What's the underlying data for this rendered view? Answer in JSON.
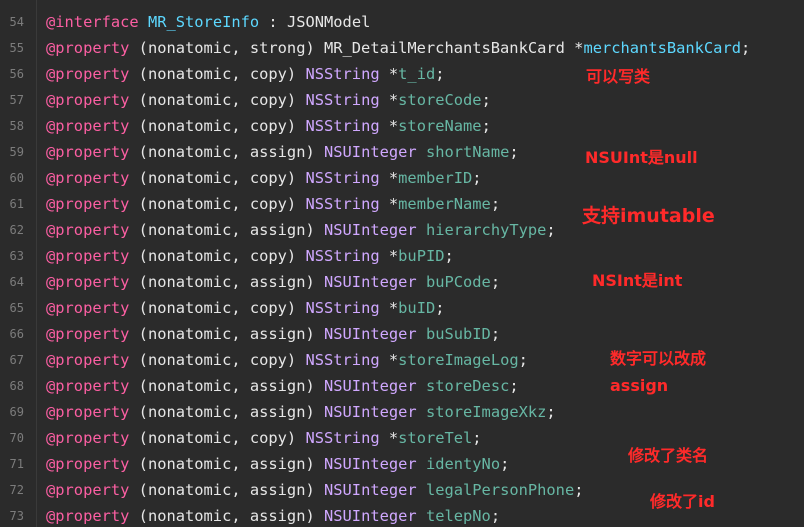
{
  "lines": [
    {
      "num": "54",
      "tokens": [
        {
          "t": "@interface",
          "c": "kw"
        },
        {
          "t": " ",
          "c": "plain"
        },
        {
          "t": "MR_StoreInfo",
          "c": "cls"
        },
        {
          "t": " : JSONModel",
          "c": "plain"
        }
      ]
    },
    {
      "num": "55",
      "tokens": [
        {
          "t": "@property",
          "c": "kw"
        },
        {
          "t": " (nonatomic, strong) MR_DetailMerchantsBankCard *",
          "c": "plain"
        },
        {
          "t": "merchantsBankCard",
          "c": "cls"
        },
        {
          "t": ";",
          "c": "plain"
        }
      ]
    },
    {
      "num": "56",
      "tokens": [
        {
          "t": "@property",
          "c": "kw"
        },
        {
          "t": " (nonatomic, copy) ",
          "c": "plain"
        },
        {
          "t": "NSString",
          "c": "type"
        },
        {
          "t": " *",
          "c": "plain"
        },
        {
          "t": "t_id",
          "c": "prop"
        },
        {
          "t": ";",
          "c": "plain"
        }
      ]
    },
    {
      "num": "57",
      "tokens": [
        {
          "t": "@property",
          "c": "kw"
        },
        {
          "t": " (nonatomic, copy) ",
          "c": "plain"
        },
        {
          "t": "NSString",
          "c": "type"
        },
        {
          "t": " *",
          "c": "plain"
        },
        {
          "t": "storeCode",
          "c": "prop"
        },
        {
          "t": ";",
          "c": "plain"
        }
      ]
    },
    {
      "num": "58",
      "tokens": [
        {
          "t": "@property",
          "c": "kw"
        },
        {
          "t": " (nonatomic, copy) ",
          "c": "plain"
        },
        {
          "t": "NSString",
          "c": "type"
        },
        {
          "t": " *",
          "c": "plain"
        },
        {
          "t": "storeName",
          "c": "prop"
        },
        {
          "t": ";",
          "c": "plain"
        }
      ]
    },
    {
      "num": "59",
      "tokens": [
        {
          "t": "@property",
          "c": "kw"
        },
        {
          "t": " (nonatomic, assign) ",
          "c": "plain"
        },
        {
          "t": "NSUInteger",
          "c": "type"
        },
        {
          "t": " ",
          "c": "plain"
        },
        {
          "t": "shortName",
          "c": "prop"
        },
        {
          "t": ";",
          "c": "plain"
        }
      ]
    },
    {
      "num": "60",
      "tokens": [
        {
          "t": "@property",
          "c": "kw"
        },
        {
          "t": " (nonatomic, copy) ",
          "c": "plain"
        },
        {
          "t": "NSString",
          "c": "type"
        },
        {
          "t": " *",
          "c": "plain"
        },
        {
          "t": "memberID",
          "c": "prop"
        },
        {
          "t": ";",
          "c": "plain"
        }
      ]
    },
    {
      "num": "61",
      "tokens": [
        {
          "t": "@property",
          "c": "kw"
        },
        {
          "t": " (nonatomic, copy) ",
          "c": "plain"
        },
        {
          "t": "NSString",
          "c": "type"
        },
        {
          "t": " *",
          "c": "plain"
        },
        {
          "t": "memberName",
          "c": "prop"
        },
        {
          "t": ";",
          "c": "plain"
        }
      ]
    },
    {
      "num": "62",
      "tokens": [
        {
          "t": "@property",
          "c": "kw"
        },
        {
          "t": " (nonatomic, assign) ",
          "c": "plain"
        },
        {
          "t": "NSUInteger",
          "c": "type"
        },
        {
          "t": " ",
          "c": "plain"
        },
        {
          "t": "hierarchyType",
          "c": "prop"
        },
        {
          "t": ";",
          "c": "plain"
        }
      ]
    },
    {
      "num": "63",
      "tokens": [
        {
          "t": "@property",
          "c": "kw"
        },
        {
          "t": " (nonatomic, copy) ",
          "c": "plain"
        },
        {
          "t": "NSString",
          "c": "type"
        },
        {
          "t": " *",
          "c": "plain"
        },
        {
          "t": "buPID",
          "c": "prop"
        },
        {
          "t": ";",
          "c": "plain"
        }
      ]
    },
    {
      "num": "64",
      "tokens": [
        {
          "t": "@property",
          "c": "kw"
        },
        {
          "t": " (nonatomic, assign) ",
          "c": "plain"
        },
        {
          "t": "NSUInteger",
          "c": "type"
        },
        {
          "t": " ",
          "c": "plain"
        },
        {
          "t": "buPCode",
          "c": "prop"
        },
        {
          "t": ";",
          "c": "plain"
        }
      ]
    },
    {
      "num": "65",
      "tokens": [
        {
          "t": "@property",
          "c": "kw"
        },
        {
          "t": " (nonatomic, copy) ",
          "c": "plain"
        },
        {
          "t": "NSString",
          "c": "type"
        },
        {
          "t": " *",
          "c": "plain"
        },
        {
          "t": "buID",
          "c": "prop"
        },
        {
          "t": ";",
          "c": "plain"
        }
      ]
    },
    {
      "num": "66",
      "tokens": [
        {
          "t": "@property",
          "c": "kw"
        },
        {
          "t": " (nonatomic, assign) ",
          "c": "plain"
        },
        {
          "t": "NSUInteger",
          "c": "type"
        },
        {
          "t": " ",
          "c": "plain"
        },
        {
          "t": "buSubID",
          "c": "prop"
        },
        {
          "t": ";",
          "c": "plain"
        }
      ]
    },
    {
      "num": "67",
      "tokens": [
        {
          "t": "@property",
          "c": "kw"
        },
        {
          "t": " (nonatomic, copy) ",
          "c": "plain"
        },
        {
          "t": "NSString",
          "c": "type"
        },
        {
          "t": " *",
          "c": "plain"
        },
        {
          "t": "storeImageLog",
          "c": "prop"
        },
        {
          "t": ";",
          "c": "plain"
        }
      ]
    },
    {
      "num": "68",
      "tokens": [
        {
          "t": "@property",
          "c": "kw"
        },
        {
          "t": " (nonatomic, assign) ",
          "c": "plain"
        },
        {
          "t": "NSUInteger",
          "c": "type"
        },
        {
          "t": " ",
          "c": "plain"
        },
        {
          "t": "storeDesc",
          "c": "prop"
        },
        {
          "t": ";",
          "c": "plain"
        }
      ]
    },
    {
      "num": "69",
      "tokens": [
        {
          "t": "@property",
          "c": "kw"
        },
        {
          "t": " (nonatomic, assign) ",
          "c": "plain"
        },
        {
          "t": "NSUInteger",
          "c": "type"
        },
        {
          "t": " ",
          "c": "plain"
        },
        {
          "t": "storeImageXkz",
          "c": "prop"
        },
        {
          "t": ";",
          "c": "plain"
        }
      ]
    },
    {
      "num": "70",
      "tokens": [
        {
          "t": "@property",
          "c": "kw"
        },
        {
          "t": " (nonatomic, copy) ",
          "c": "plain"
        },
        {
          "t": "NSString",
          "c": "type"
        },
        {
          "t": " *",
          "c": "plain"
        },
        {
          "t": "storeTel",
          "c": "prop"
        },
        {
          "t": ";",
          "c": "plain"
        }
      ]
    },
    {
      "num": "71",
      "tokens": [
        {
          "t": "@property",
          "c": "kw"
        },
        {
          "t": " (nonatomic, assign) ",
          "c": "plain"
        },
        {
          "t": "NSUInteger",
          "c": "type"
        },
        {
          "t": " ",
          "c": "plain"
        },
        {
          "t": "identyNo",
          "c": "prop"
        },
        {
          "t": ";",
          "c": "plain"
        }
      ]
    },
    {
      "num": "72",
      "tokens": [
        {
          "t": "@property",
          "c": "kw"
        },
        {
          "t": " (nonatomic, assign) ",
          "c": "plain"
        },
        {
          "t": "NSUInteger",
          "c": "type"
        },
        {
          "t": " ",
          "c": "plain"
        },
        {
          "t": "legalPersonPhone",
          "c": "prop"
        },
        {
          "t": ";",
          "c": "plain"
        }
      ]
    },
    {
      "num": "73",
      "tokens": [
        {
          "t": "@property",
          "c": "kw"
        },
        {
          "t": " (nonatomic, assign) ",
          "c": "plain"
        },
        {
          "t": "NSUInteger",
          "c": "type"
        },
        {
          "t": " ",
          "c": "plain"
        },
        {
          "t": "telepNo",
          "c": "prop"
        },
        {
          "t": ";",
          "c": "plain"
        }
      ]
    }
  ],
  "annotations": {
    "a1": "可以写类",
    "a2": "NSUInt是null",
    "a3": "支持imutable",
    "a4": "NSInt是int",
    "a5_line1": "数字可以改成",
    "a5_line2": "assign",
    "a6": "修改了类名",
    "a7": "修改了id"
  },
  "colors": {
    "background": "#2b2b2b",
    "keyword": "#fc5fa3",
    "class": "#5dd8ff",
    "type": "#d0a8ff",
    "property": "#67b7a4",
    "annotation": "#ff2a2a"
  }
}
